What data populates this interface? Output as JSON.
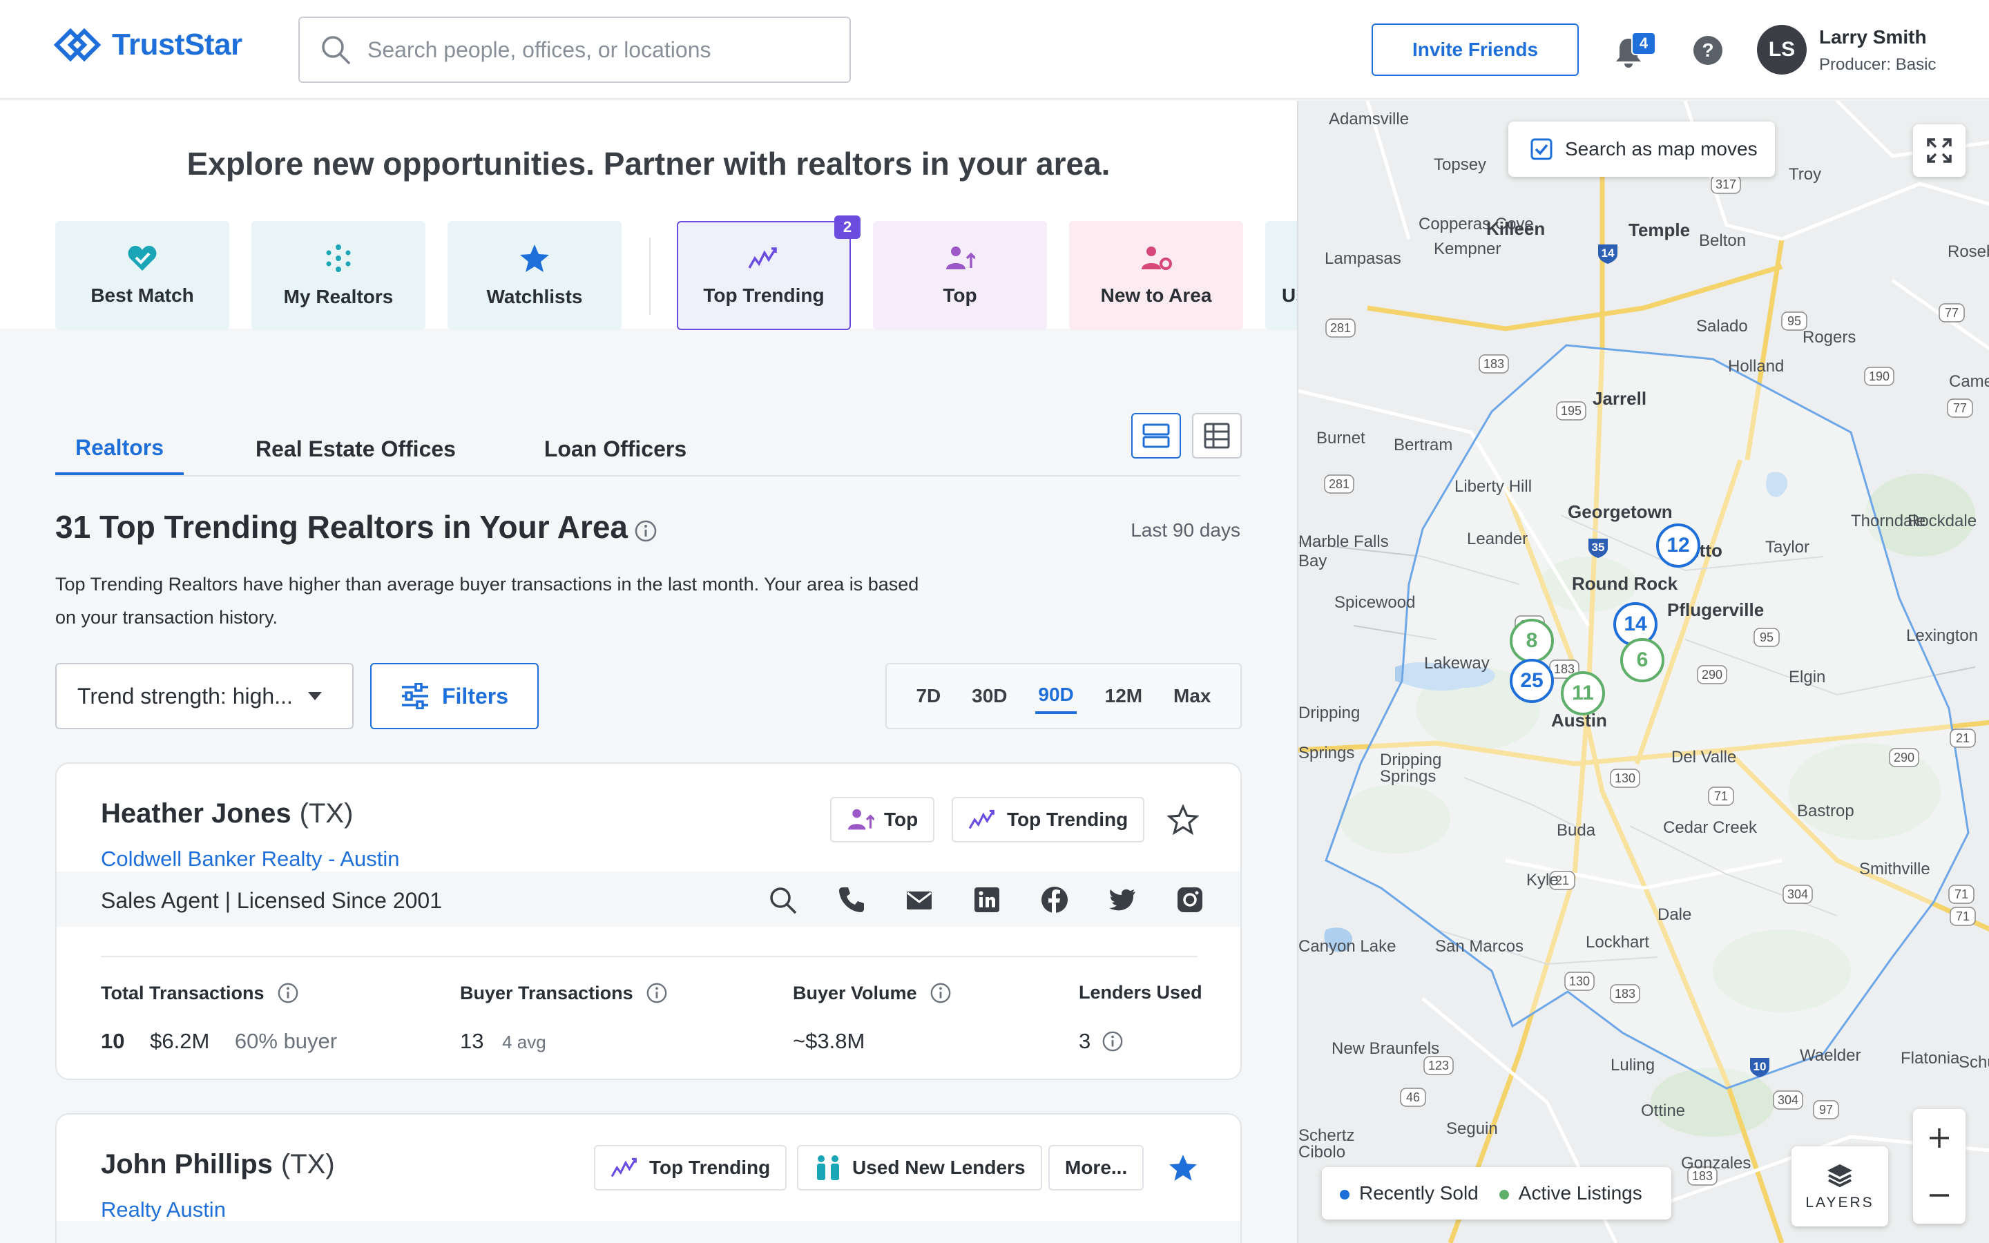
{
  "header": {
    "logo_text": "TrustStar",
    "search_placeholder": "Search people, offices, or locations",
    "invite_label": "Invite Friends",
    "notification_count": "4",
    "user_initials": "LS",
    "user_name": "Larry Smith",
    "user_role": "Producer: Basic"
  },
  "hero": {
    "title": "Explore new opportunities. Partner with realtors in your area.",
    "categories": [
      {
        "label": "Best Match",
        "icon": "heart-check-icon",
        "bg": "#e8f4f6",
        "color": "#1aa6b7"
      },
      {
        "label": "My Realtors",
        "icon": "network-icon",
        "bg": "#e8f4f6",
        "color": "#1aa6b7"
      },
      {
        "label": "Watchlists",
        "icon": "star-icon",
        "bg": "#e8f4f6",
        "color": "#1e6fd9"
      },
      {
        "label": "Top Trending",
        "icon": "trending-icon",
        "bg": "#eef1fb",
        "color": "#6b4ce0",
        "badge": "2"
      },
      {
        "label": "Top",
        "icon": "person-up-icon",
        "bg": "#f5eefa",
        "color": "#9b59c7"
      },
      {
        "label": "New to Area",
        "icon": "person-gear-icon",
        "bg": "#fcecf1",
        "color": "#d8477a"
      },
      {
        "label": "Us",
        "icon": "",
        "bg": "#e8f4f6",
        "color": "#1aa6b7"
      }
    ]
  },
  "tabs": {
    "items": [
      "Realtors",
      "Real Estate Offices",
      "Loan Officers"
    ],
    "active": "Realtors"
  },
  "section": {
    "title": "31 Top Trending Realtors in Your Area",
    "range_label": "Last 90 days",
    "description": "Top Trending Realtors have higher than average buyer transactions in the last month. Your area is based on your transaction history."
  },
  "controls": {
    "trend_select": "Trend strength: high...",
    "filters_label": "Filters",
    "ranges": [
      "7D",
      "30D",
      "90D",
      "12M",
      "Max"
    ],
    "active_range": "90D"
  },
  "realtors": [
    {
      "name": "Heather Jones",
      "state": "(TX)",
      "office": "Coldwell Banker Realty - Austin",
      "role": "Sales Agent  |  Licensed Since 2001",
      "tags": [
        "Top",
        "Top Trending"
      ],
      "starred": false,
      "stats": {
        "total_label": "Total Transactions",
        "total_count": "10",
        "total_volume": "$6.2M",
        "total_buyer": "60% buyer",
        "buyer_label": "Buyer Transactions",
        "buyer_count": "13",
        "buyer_avg": "4 avg",
        "volume_label": "Buyer Volume",
        "volume_value": "~$3.8M",
        "lenders_label": "Lenders Used",
        "lenders_value": "3"
      }
    },
    {
      "name": "John Phillips",
      "state": "(TX)",
      "office": "Realty Austin",
      "tags": [
        "Top Trending",
        "Used New Lenders",
        "More..."
      ],
      "starred": true
    }
  ],
  "map": {
    "search_as_moves": "Search as map moves",
    "legend_sold": "Recently Sold",
    "legend_active": "Active Listings",
    "layers_label": "LAYERS",
    "clusters": [
      {
        "count": "12",
        "color": "blue"
      },
      {
        "count": "14",
        "color": "blue"
      },
      {
        "count": "8",
        "color": "green"
      },
      {
        "count": "6",
        "color": "green"
      },
      {
        "count": "25",
        "color": "blue"
      },
      {
        "count": "11",
        "color": "green"
      }
    ],
    "places": [
      "Adamsville",
      "Topsey",
      "Troy",
      "Copperas Cove",
      "Killeen",
      "Kempner",
      "Temple",
      "Lampasas",
      "Belton",
      "Rosebud",
      "Salado",
      "Rogers",
      "Holland",
      "Cameron",
      "Jarrell",
      "Burnet",
      "Bertram",
      "Liberty Hill",
      "Georgetown",
      "Rockdale",
      "Marble Falls",
      "Leander",
      "Taylor",
      "Thorndale",
      "Round Rock",
      "Hutto",
      "Spicewood",
      "Pflugerville",
      "Lexington",
      "Lakeway",
      "Elgin",
      "Austin",
      "Dripping Springs",
      "Del Valle",
      "Bastrop",
      "Buda",
      "Cedar Creek",
      "Smithville",
      "Kyle",
      "Dale",
      "Lockhart",
      "San Marcos",
      "Canyon Lake",
      "New Braunfels",
      "Waelder",
      "Flatonia",
      "Luling",
      "Seguin",
      "Ottine",
      "Gonzales",
      "Schertz"
    ]
  }
}
